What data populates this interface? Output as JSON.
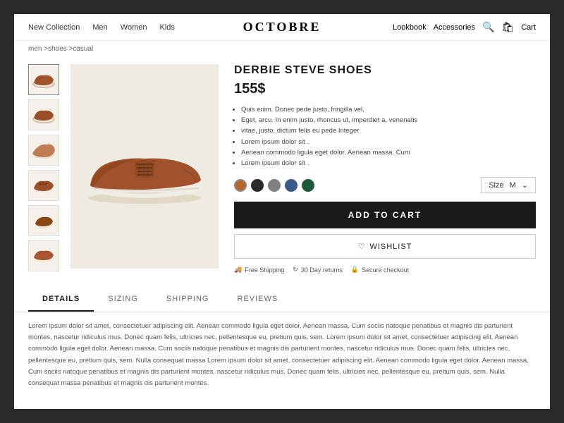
{
  "brand": "OCTOBRE",
  "nav": {
    "links": [
      {
        "label": "New Collection"
      },
      {
        "label": "Men"
      },
      {
        "label": "Women"
      },
      {
        "label": "Kids"
      },
      {
        "label": "Lookbook"
      },
      {
        "label": "Accessories"
      }
    ],
    "cart_label": "Cart"
  },
  "breadcrumb": "men >shoes >casual",
  "product": {
    "title": "DERBIE STEVE SHOES",
    "price": "155$",
    "description": [
      "Quis enim. Donec pede justo, fringilla vel,",
      "Eget, arcu. In enim justo, rhoncus ut, imperdiet a, venenatis",
      "vitae, justo. dictum felis eu pede  Integer",
      "Lorem ipsum dolor sit .",
      "Aenean commodo ligula eget dolor. Aenean massa. Cum",
      "Lorem ipsum dolor sit ."
    ],
    "swatches": [
      {
        "color": "#b5682a",
        "name": "brown"
      },
      {
        "color": "#2a2a2a",
        "name": "black"
      },
      {
        "color": "#808080",
        "name": "gray"
      },
      {
        "color": "#3a5a8a",
        "name": "navy"
      },
      {
        "color": "#1a5a3a",
        "name": "green"
      }
    ],
    "size_label": "Size",
    "size_value": "M",
    "add_to_cart": "ADD TO CART",
    "wishlist": "WISHLIST",
    "features": [
      {
        "icon": "truck",
        "label": "Free Shipping"
      },
      {
        "icon": "refresh",
        "label": "30 Day returns"
      },
      {
        "icon": "lock",
        "label": "Secure checkout"
      }
    ]
  },
  "tabs": [
    {
      "label": "DETAILS",
      "active": true
    },
    {
      "label": "SIZING",
      "active": false
    },
    {
      "label": "SHIPPING",
      "active": false
    },
    {
      "label": "REVIEWS",
      "active": false
    }
  ],
  "details_text": "Lorem ipsum dolor sit amet, consectetuer adipiscing elit. Aenean commodo ligula eget dolor. Aenean massa. Cum sociis natoque penatibus et magnis dis parturient montes, nascetur ridiculus mus. Donec quam felis, ultricies nec, pellentesque eu, pretium quis, sem. Lorem ipsum dolor sit amet, consectetuer adipiscing elit. Aenean commodo ligula eget dolor. Aenean massa. Cum sociis natoque penatibus et magnis dis parturient montes, nascetur ridiculus mus. Donec quam felis, ultricies nec, pellentesque eu, pretium quis, sem.\nNulla consequat massa\nLorem ipsum dolor sit amet, consectetuer adipiscing elit. Aenean commodo ligula eget dolor. Aenean massa. Cum sociis natoque penatibus et magnis dis parturient montes, nascetur ridiculus mus. Donec quam felis, ultricies nec, pellentesque eu, pretium quis, sem.\nNulla consequat massa penatibus et magnis dis parturient montes.",
  "thumbnails": [
    {
      "label": "thumb-1"
    },
    {
      "label": "thumb-2"
    },
    {
      "label": "thumb-3"
    },
    {
      "label": "thumb-4"
    },
    {
      "label": "thumb-5"
    },
    {
      "label": "thumb-6"
    }
  ]
}
